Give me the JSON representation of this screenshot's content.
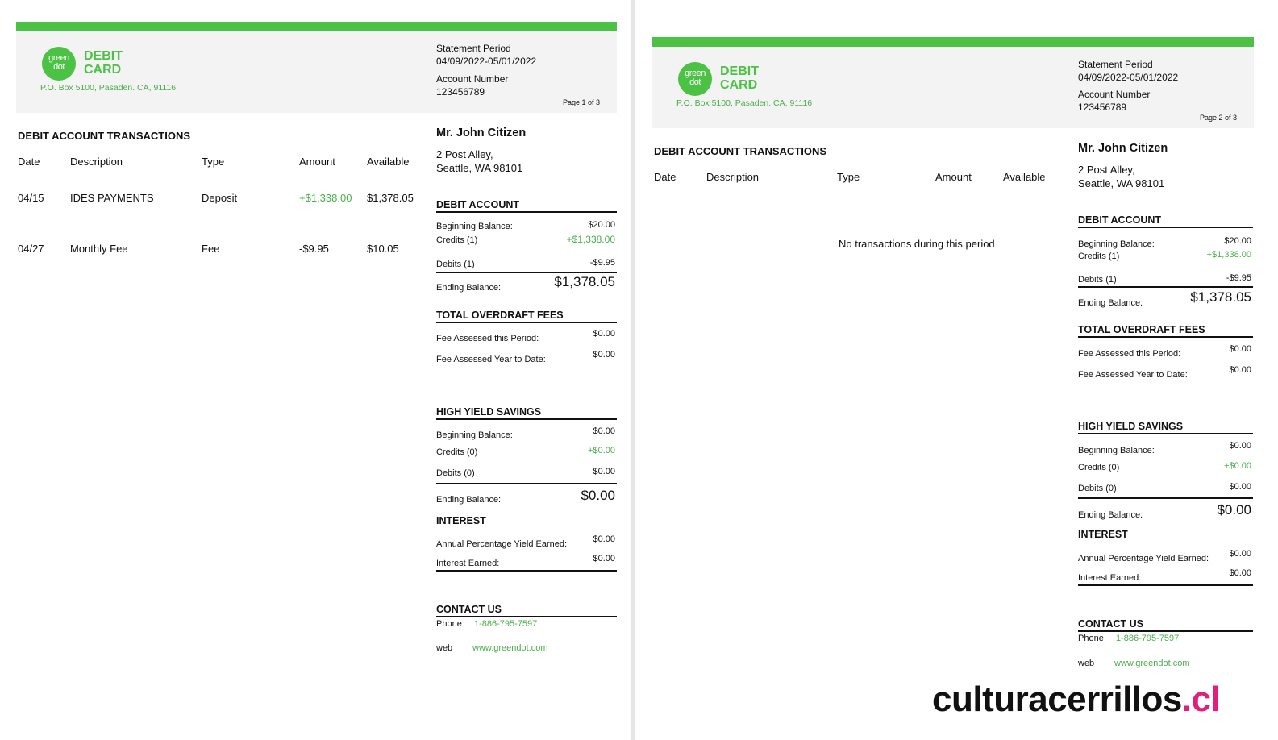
{
  "colors": {
    "brand_green": "#4cc244",
    "link_green": "#4cae4c",
    "header_bg": "#f3f3f3"
  },
  "pages": [
    {
      "logo": {
        "line1": "green",
        "line2": "dot",
        "title_line1": "DEBIT",
        "title_line2": "CARD"
      },
      "address": "P.O. Box 5100, Pasaden. CA, 91116",
      "statement_period_label": "Statement Period",
      "statement_period": "04/09/2022-05/01/2022",
      "account_number_label": "Account Number",
      "account_number": "123456789",
      "page_label": "Page 1 of 3",
      "transactions": {
        "title": "DEBIT ACCOUNT TRANSACTIONS",
        "columns": [
          "Date",
          "Description",
          "Type",
          "Amount",
          "Available"
        ],
        "rows": [
          {
            "date": "04/15",
            "description": "IDES PAYMENTS",
            "type": "Deposit",
            "amount": "+$1,338.00",
            "available": "$1,378.05"
          },
          {
            "date": "04/27",
            "description": "Monthly Fee",
            "type": "Fee",
            "amount": "-$9.95",
            "available": "$10.05"
          }
        ]
      },
      "customer": {
        "name": "Mr. John Citizen",
        "street": "2 Post Alley,",
        "city": "Seattle, WA 98101"
      },
      "debit_account": {
        "title": "DEBIT ACCOUNT",
        "beginning_label": "Beginning Balance:",
        "beginning": "$20.00",
        "credits_label": "Credits (1)",
        "credits": "+$1,338.00",
        "debits_label": "Debits (1)",
        "debits": "-$9.95",
        "ending_label": "Ending Balance:",
        "ending": "$1,378.05"
      },
      "overdraft": {
        "title": "TOTAL OVERDRAFT FEES",
        "period_label": "Fee Assessed this Period:",
        "period": "$0.00",
        "ytd_label": "Fee Assessed Year to Date:",
        "ytd": "$0.00"
      },
      "savings": {
        "title": "HIGH YIELD SAVINGS",
        "beginning_label": "Beginning Balance:",
        "beginning": "$0.00",
        "credits_label": "Credits (0)",
        "credits": "+$0.00",
        "debits_label": "Debits (0)",
        "debits": "$0.00",
        "ending_label": "Ending Balance:",
        "ending": "$0.00"
      },
      "interest": {
        "title": "INTEREST",
        "apy_label": "Annual Percentage Yield Earned:",
        "apy": "$0.00",
        "earned_label": "Interest Earned:",
        "earned": "$0.00"
      },
      "contact": {
        "title": "CONTACT US",
        "phone_label": "Phone",
        "phone": "1-886-795-7597",
        "web_label": "web",
        "web": "www.greendot.com"
      }
    },
    {
      "logo": {
        "line1": "green",
        "line2": "dot",
        "title_line1": "DEBIT",
        "title_line2": "CARD"
      },
      "address": "P.O. Box 5100, Pasaden. CA, 91116",
      "statement_period_label": "Statement Period",
      "statement_period": "04/09/2022-05/01/2022",
      "account_number_label": "Account Number",
      "account_number": "123456789",
      "page_label": "Page 2 of 3",
      "transactions": {
        "title": "DEBIT ACCOUNT TRANSACTIONS",
        "columns": [
          "Date",
          "Description",
          "Type",
          "Amount",
          "Available"
        ],
        "empty_message": "No transactions during this period"
      },
      "customer": {
        "name": "Mr. John Citizen",
        "street": "2 Post Alley,",
        "city": "Seattle, WA 98101"
      },
      "debit_account": {
        "title": "DEBIT ACCOUNT",
        "beginning_label": "Beginning Balance:",
        "beginning": "$20.00",
        "credits_label": "Credits (1)",
        "credits": "+$1,338.00",
        "debits_label": "Debits (1)",
        "debits": "-$9.95",
        "ending_label": "Ending Balance:",
        "ending": "$1,378.05"
      },
      "overdraft": {
        "title": "TOTAL OVERDRAFT FEES",
        "period_label": "Fee Assessed this Period:",
        "period": "$0.00",
        "ytd_label": "Fee Assessed Year to Date:",
        "ytd": "$0.00"
      },
      "savings": {
        "title": "HIGH YIELD SAVINGS",
        "beginning_label": "Beginning Balance:",
        "beginning": "$0.00",
        "credits_label": "Credits (0)",
        "credits": "+$0.00",
        "debits_label": "Debits (0)",
        "debits": "$0.00",
        "ending_label": "Ending Balance:",
        "ending": "$0.00"
      },
      "interest": {
        "title": "INTEREST",
        "apy_label": "Annual Percentage Yield Earned:",
        "apy": "$0.00",
        "earned_label": "Interest Earned:",
        "earned": "$0.00"
      },
      "contact": {
        "title": "CONTACT US",
        "phone_label": "Phone",
        "phone": "1-886-795-7597",
        "web_label": "web",
        "web": "www.greendot.com"
      }
    }
  ],
  "watermark": {
    "main": "culturacerrillos",
    "tld": ".cl"
  }
}
